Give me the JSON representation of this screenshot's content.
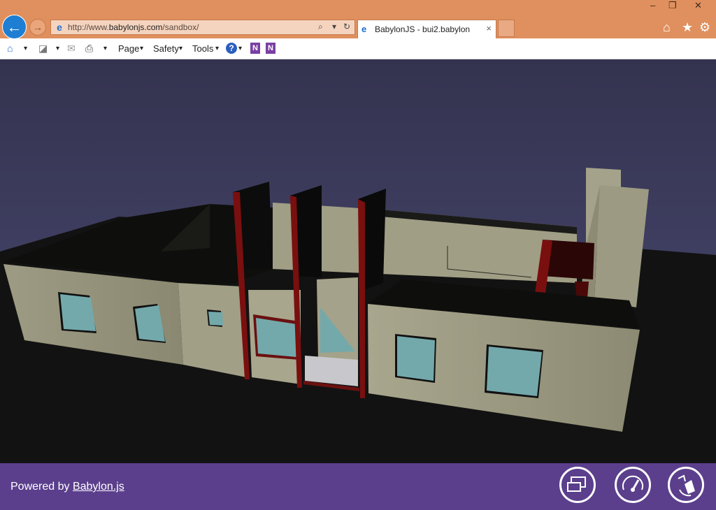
{
  "browser": {
    "url_prefix": "http://www.",
    "url_domain": "babylonjs.com",
    "url_path": "/sandbox/",
    "tab_title": "BabylonJS - bui2.babylon",
    "tab_close": "×",
    "back_glyph": "←",
    "forward_glyph": "→",
    "search_glyph": "⌕",
    "dropdown_glyph": "▾",
    "refresh_glyph": "↻",
    "minimize_glyph": "–",
    "restore_glyph": "❐",
    "close_glyph": "✕",
    "home_glyph": "⌂",
    "favorites_glyph": "★",
    "settings_glyph": "⚙"
  },
  "commandbar": {
    "home_glyph": "⌂",
    "feeds_glyph": "◪",
    "mail_glyph": "✉",
    "print_glyph": "⎙",
    "page_label": "Page",
    "safety_label": "Safety",
    "tools_label": "Tools",
    "help_glyph": "?",
    "onenote_label": "N",
    "onenote2_label": "N",
    "caret": "▾"
  },
  "footer": {
    "powered_by": "Powered by ",
    "babylon_link": "Babylon.js"
  },
  "colors": {
    "titlebar": "#e0905e",
    "sky": "#3b3a5e",
    "ground": "#121212",
    "wall_beige": "#9c9a80",
    "window_glass": "#74a9ab",
    "footer_purple": "#5b3f8c"
  },
  "icons": {
    "back": "back-arrow-icon",
    "forward": "forward-arrow-icon",
    "fullscreen": "fullscreen-icon",
    "performance": "gauge-icon",
    "camera": "camera-reset-icon"
  }
}
